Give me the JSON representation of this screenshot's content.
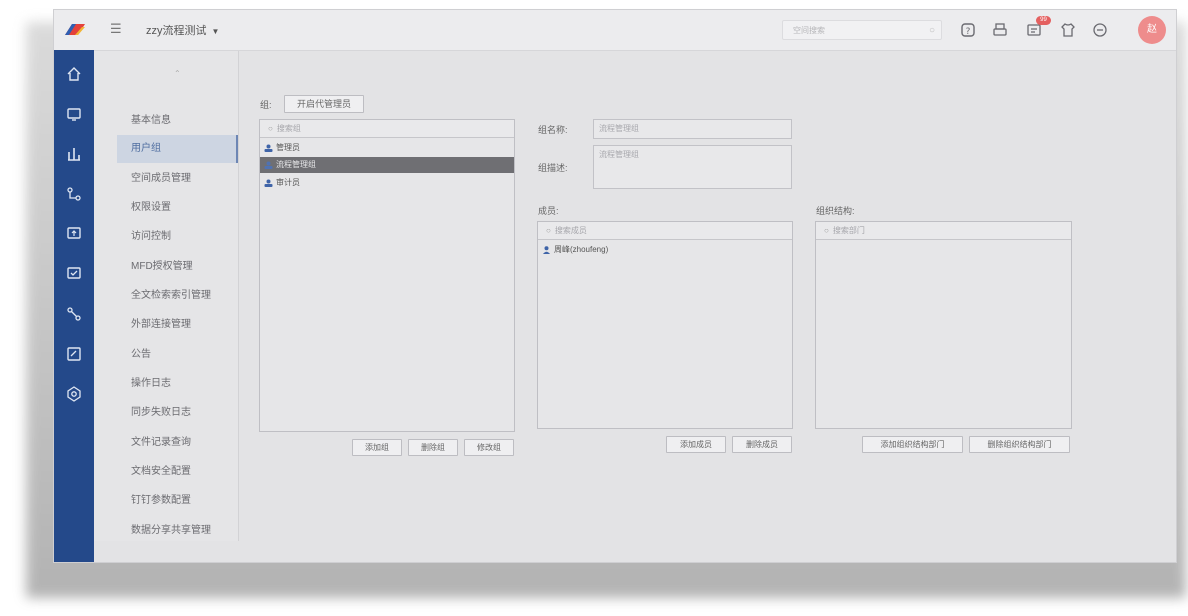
{
  "header": {
    "workspace": "zzy流程测试",
    "search_placeholder": "空间搜索",
    "notification_count": "99",
    "avatar_text": "赵"
  },
  "sidemenu": {
    "items": [
      {
        "label": "基本信息"
      },
      {
        "label": "用户组"
      },
      {
        "label": "空间成员管理"
      },
      {
        "label": "权限设置"
      },
      {
        "label": "访问控制"
      },
      {
        "label": "MFD授权管理"
      },
      {
        "label": "全文检索索引管理"
      },
      {
        "label": "外部连接管理"
      },
      {
        "label": "公告"
      },
      {
        "label": "操作日志"
      },
      {
        "label": "同步失败日志"
      },
      {
        "label": "文件记录查询"
      },
      {
        "label": "文档安全配置"
      },
      {
        "label": "钉钉参数配置"
      },
      {
        "label": "数据分享共享管理"
      }
    ]
  },
  "groups": {
    "label": "组:",
    "enable_button": "开启代管理员",
    "search_placeholder": "搜索组",
    "list": [
      {
        "name": "管理员"
      },
      {
        "name": "流程管理组"
      },
      {
        "name": "审计员"
      }
    ],
    "add_button": "添加组",
    "delete_button": "删除组",
    "edit_button": "修改组"
  },
  "details": {
    "name_label": "组名称:",
    "name_value": "流程管理组",
    "desc_label": "组描述:",
    "desc_value": "流程管理组"
  },
  "members": {
    "label": "成员:",
    "search_placeholder": "搜索成员",
    "list": [
      {
        "name": "周峰(zhoufeng)"
      }
    ],
    "add_button": "添加成员",
    "delete_button": "删除成员"
  },
  "org": {
    "label": "组织结构:",
    "search_placeholder": "搜索部门",
    "add_button": "添加组织结构部门",
    "delete_button": "删除组织结构部门"
  },
  "colors": {
    "rail": "#24498a",
    "active_menu": "#cdd5e2",
    "selected_row": "#6f6f73",
    "avatar": "#ee8c8c",
    "badge": "#e46060"
  }
}
